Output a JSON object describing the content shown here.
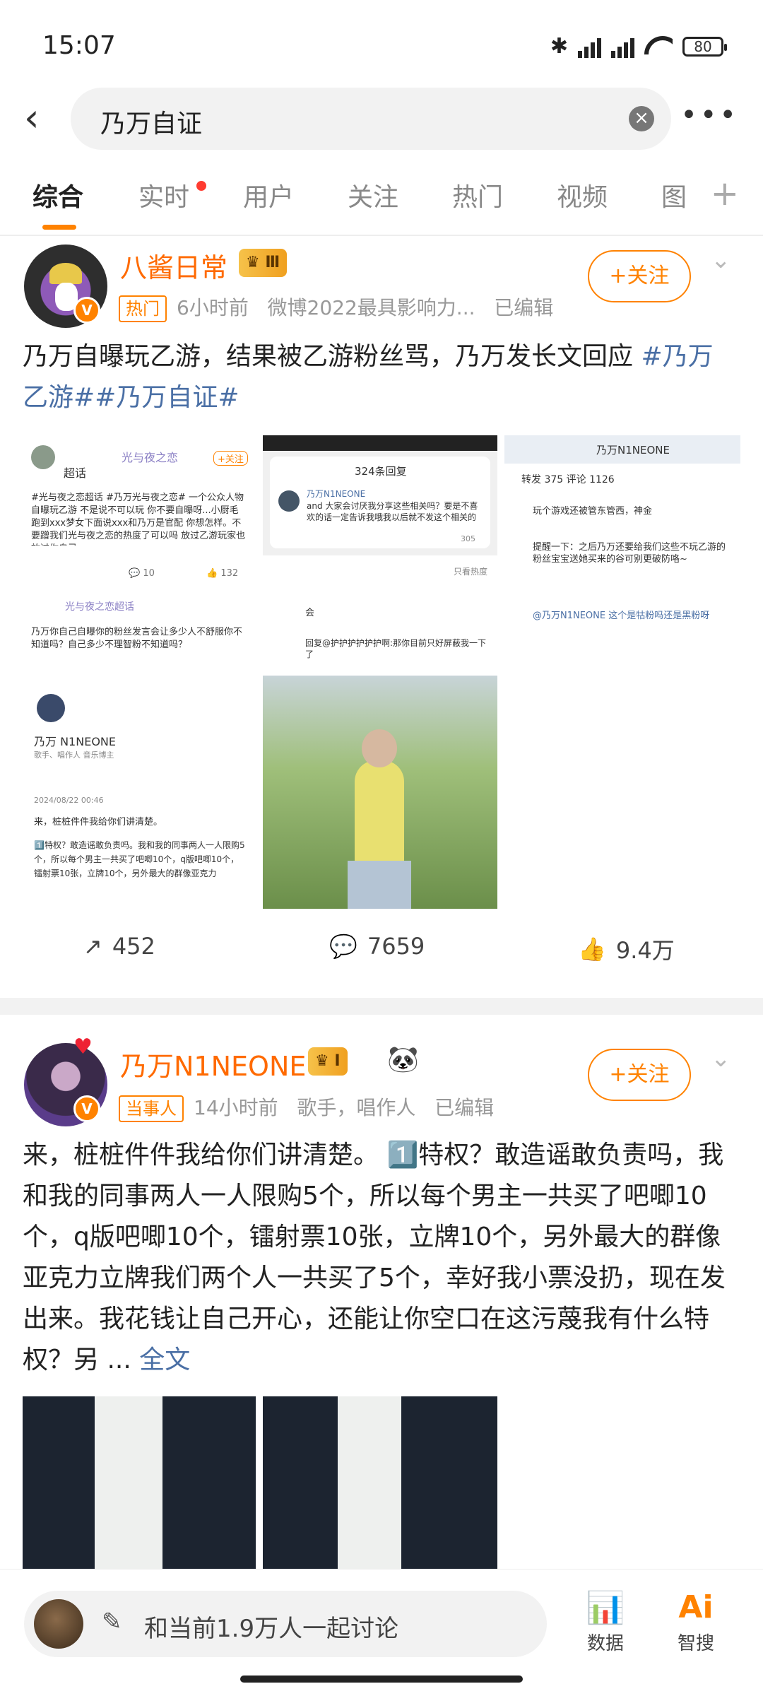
{
  "status_bar": {
    "time": "15:07",
    "battery": "80"
  },
  "search": {
    "query": "乃万自证"
  },
  "tabs": [
    {
      "label": "综合"
    },
    {
      "label": "实时"
    },
    {
      "label": "用户"
    },
    {
      "label": "关注"
    },
    {
      "label": "热门"
    },
    {
      "label": "视频"
    },
    {
      "label": "图"
    }
  ],
  "post1": {
    "username": "八酱日常",
    "level": "Ⅲ",
    "tag": "热门",
    "time": "6小时前",
    "source": "微博2022最具影响力...",
    "edited": "已编辑",
    "follow": "+关注",
    "text_before": "乃万自曝玩乙游，结果被乙游粉丝骂，乃万发长文回应 ",
    "hashtags": "#乃万 乙游##乃万自证#",
    "images": {
      "img1": {
        "topic": "光与夜之恋",
        "sub": "超话",
        "body": "#光与夜之恋超话 #乃万光与夜之恋# 一个公众人物 自曝玩乙游 不是说不可以玩 你不要自曝呀...小厨毛跑到xxx梦女下面说xxx和乃万是官配 你想怎样。不要蹭我们光与夜之恋的热度了可以吗 放过乙游玩家也放过你自己",
        "comments": "10",
        "likes": "132"
      },
      "img2": {
        "header": "324条回复",
        "name": "乃万N1NEONE",
        "body": "and 大家会讨厌我分享这些相关吗？要是不喜欢的话一定告诉我哦我以后就不发这个相关的",
        "likes": "305"
      },
      "img3": {
        "header": "乃万N1NEONE",
        "tabs": "转发 375   评论 1126",
        "c1": "玩个游戏还被管东管西，神金",
        "c2": "提醒一下：之后乃万还要给我们这些不玩乙游的粉丝宝宝送她买来的谷可别更破防咯~",
        "c3": "@乃万N1NEONE 这个是牯粉吗还是黑粉呀"
      },
      "img4": {
        "topic": "光与夜之恋超话",
        "body": "乃万你自己自曝你的粉丝发言会让多少人不舒服你不知道吗？自己多少不理智粉不知道吗？"
      },
      "img5": {
        "name": "乃万 N1NEONE",
        "role": "歌手、唱作人 音乐博主",
        "date": "2024/08/22 00:46",
        "l1": "来，桩桩件件我给你们讲清楚。",
        "l2": "1️⃣特权？敢造谣敢负责吗。我和我的同事两人一人限购5个，所以每个男主一共买了吧唧10个，q版吧唧10个，镭射票10张，立牌10个，另外最大的群像亚克力"
      },
      "img6": {
        "header": "只看热度",
        "c1": "会",
        "c2": "回复@护护护护护护啊:那你目前只好屏蔽我一下了"
      }
    },
    "reposts": "452",
    "comments": "7659",
    "likes": "9.4万"
  },
  "post2": {
    "username": "乃万N1NEONE",
    "level": "Ⅰ",
    "tag": "当事人",
    "time": "14小时前",
    "source": "歌手，唱作人",
    "edited": "已编辑",
    "follow": "+关注",
    "text": "来，桩桩件件我给你们讲清楚。 1️⃣特权？敢造谣敢负责吗，我和我的同事两人一人限购5个，所以每个男主一共买了吧唧10个，q版吧唧10个，镭射票10张，立牌10个，另外最大的群像亚克力立牌我们两个人一共买了5个，幸好我小票没扔，现在发出来。我花钱让自己开心，还能让你空口在这污蔑我有什么特权？另 ...",
    "full_text_link": "全文"
  },
  "bottom_bar": {
    "discuss": "和当前1.9万人一起讨论",
    "data_label": "数据",
    "smart_label": "智搜"
  },
  "colors": {
    "accent": "#ff8200",
    "link": "#4a6fa5"
  }
}
